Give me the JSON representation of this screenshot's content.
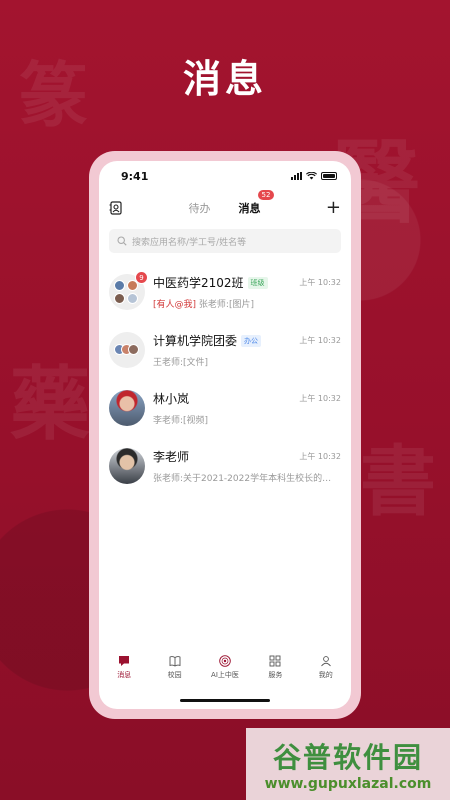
{
  "headline": "消息",
  "status_bar": {
    "time": "9:41"
  },
  "header": {
    "tabs": [
      {
        "label": "待办",
        "active": false
      },
      {
        "label": "消息",
        "active": true,
        "badge": "52"
      }
    ]
  },
  "search": {
    "placeholder": "搜索应用名称/学工号/姓名等"
  },
  "conversations": [
    {
      "name": "中医药学2102班",
      "tag": "班级",
      "time": "上午 10:32",
      "mention": "[有人@我]",
      "preview": "张老师:[图片]",
      "unread": "9"
    },
    {
      "name": "计算机学院团委",
      "tag": "办公",
      "time": "上午 10:32",
      "preview": "王老师:[文件]"
    },
    {
      "name": "林小岚",
      "time": "上午 10:32",
      "preview": "李老师:[视频]"
    },
    {
      "name": "李老师",
      "time": "上午 10:32",
      "preview": "张老师:关于2021-2022学年本科生校长的…"
    }
  ],
  "tabbar": [
    {
      "label": "消息",
      "icon": "message-icon",
      "active": true
    },
    {
      "label": "校园",
      "icon": "book-icon"
    },
    {
      "label": "AI上中医",
      "icon": "campus-logo-icon"
    },
    {
      "label": "服务",
      "icon": "grid-icon"
    },
    {
      "label": "我的",
      "icon": "person-icon"
    }
  ],
  "watermark": {
    "title": "谷普软件园",
    "url": "www.gupuxlazal.com"
  },
  "colors": {
    "brand": "#9b1230",
    "badge": "#e5484d",
    "mention": "#d23a3a"
  }
}
